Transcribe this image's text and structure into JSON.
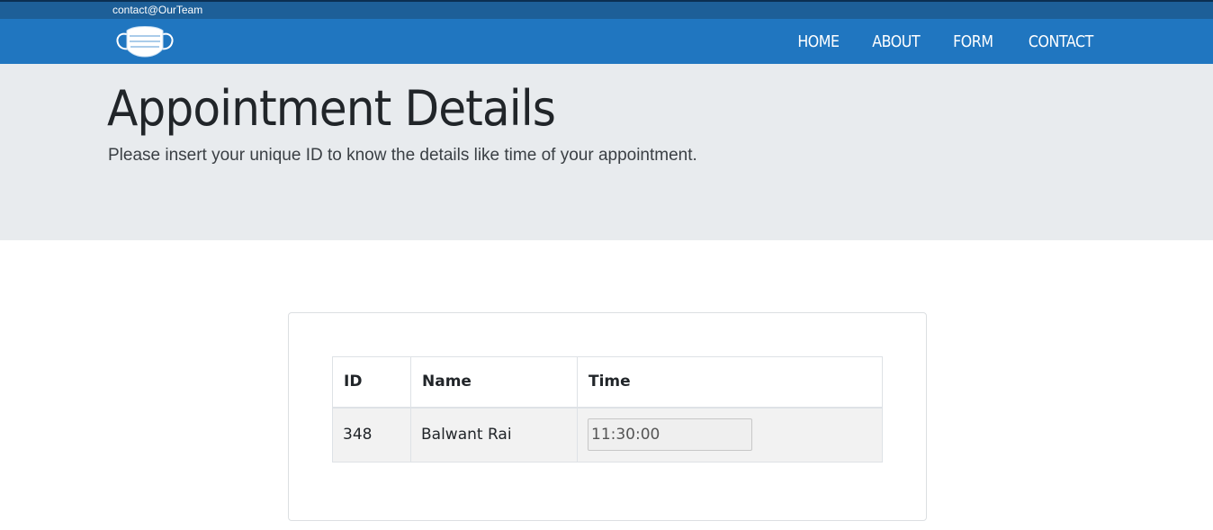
{
  "topbar": {
    "contact": "contact@OurTeam"
  },
  "nav": {
    "items": [
      {
        "label": "HOME"
      },
      {
        "label": "ABOUT"
      },
      {
        "label": "FORM"
      },
      {
        "label": "CONTACT"
      }
    ]
  },
  "header": {
    "title": "Appointment Details",
    "lead": "Please insert your unique ID to know the details like time of your appointment."
  },
  "table": {
    "columns": [
      "ID",
      "Name",
      "Time"
    ],
    "rows": [
      {
        "id": "348",
        "name": "Balwant Rai",
        "time": "11:30:00"
      }
    ]
  },
  "colors": {
    "nav_bg": "#2076c0",
    "topbar_bg": "#1d5f98",
    "jumbo_bg": "#e8ebee"
  },
  "icons": {
    "logo": "face-mask-icon"
  }
}
